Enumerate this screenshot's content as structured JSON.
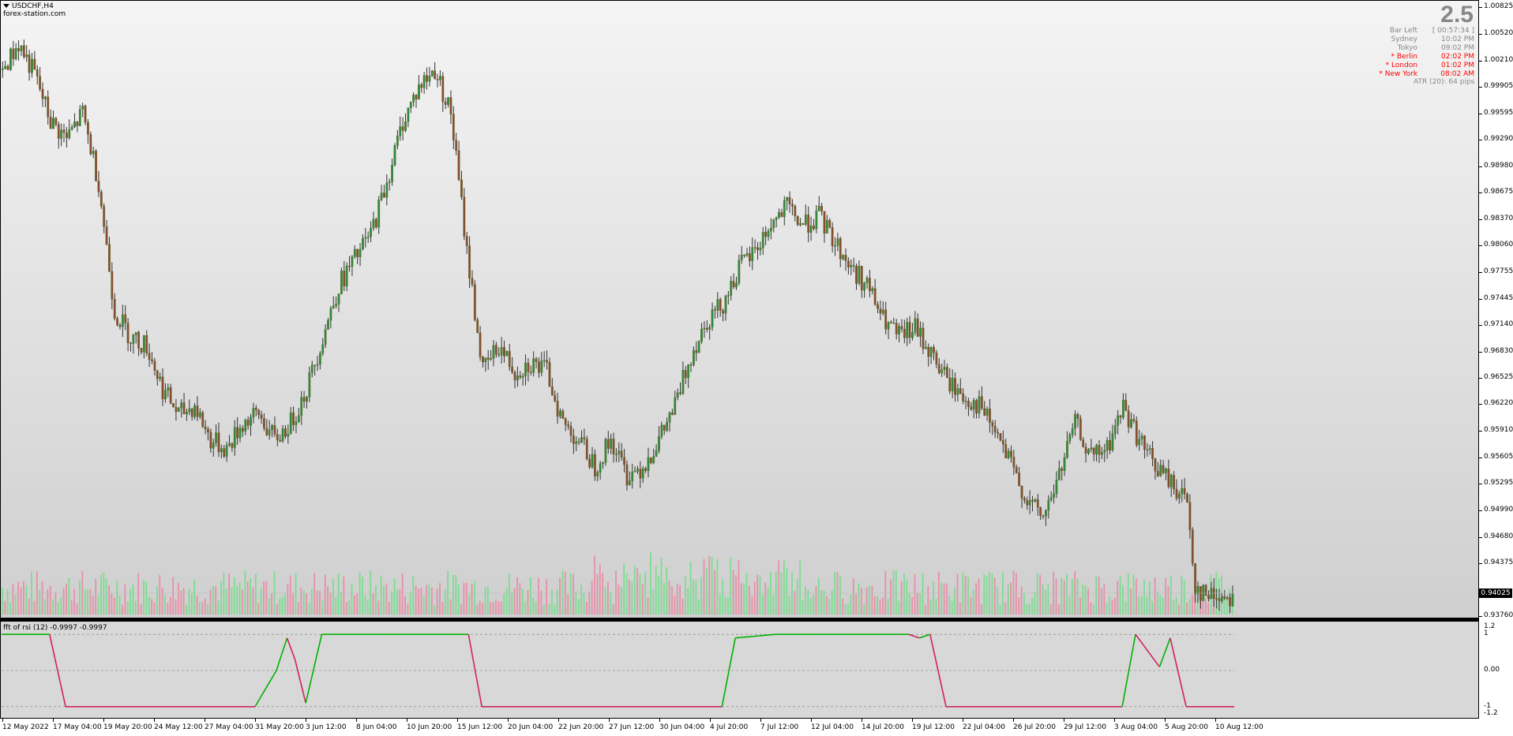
{
  "chart": {
    "symbol_label": "USDCHF,H4",
    "watermark": "forex-station.com",
    "big_value": "2.5",
    "current_price": "0.94025",
    "indicator_label": "fft of rsi (12) -0.9997 -0.9997"
  },
  "info_panel": [
    {
      "name": "Bar Left",
      "value": "[ 00:57:34 ]",
      "color": "#888888"
    },
    {
      "name": "Sydney",
      "value": "10:02 PM",
      "color": "#888888"
    },
    {
      "name": "Tokyo",
      "value": "09:02 PM",
      "color": "#888888"
    },
    {
      "name": "* Berlin",
      "value": "02:02 PM",
      "color": "#ff0000"
    },
    {
      "name": "* London",
      "value": "01:02 PM",
      "color": "#ff0000"
    },
    {
      "name": "* New York",
      "value": "08:02 AM",
      "color": "#ff0000"
    }
  ],
  "atr_label": "ATR (20): 64 pips",
  "price_axis": [
    "1.00825",
    "1.00520",
    "1.00210",
    "0.99905",
    "0.99595",
    "0.99290",
    "0.98980",
    "0.98675",
    "0.98370",
    "0.98060",
    "0.97755",
    "0.97445",
    "0.97140",
    "0.96830",
    "0.96525",
    "0.96220",
    "0.95910",
    "0.95605",
    "0.95295",
    "0.94990",
    "0.94680",
    "0.94375",
    "0.93760"
  ],
  "indicator_axis": [
    "1.2",
    "1",
    "0.00",
    "-1",
    "-1.2"
  ],
  "time_axis": [
    "12 May 2022",
    "17 May 04:00",
    "19 May 20:00",
    "24 May 12:00",
    "27 May 04:00",
    "31 May 20:00",
    "3 Jun 12:00",
    "8 Jun 04:00",
    "10 Jun 20:00",
    "15 Jun 12:00",
    "20 Jun 04:00",
    "22 Jun 20:00",
    "27 Jun 12:00",
    "30 Jun 04:00",
    "4 Jul 20:00",
    "7 Jul 12:00",
    "12 Jul 04:00",
    "14 Jul 20:00",
    "19 Jul 12:00",
    "22 Jul 04:00",
    "26 Jul 20:00",
    "29 Jul 12:00",
    "3 Aug 04:00",
    "5 Aug 20:00",
    "10 Aug 12:00"
  ],
  "colors": {
    "bull": "#00b000",
    "bear": "#ff4060",
    "candle_body": "#5a6b2a",
    "wick": "#333333"
  },
  "chart_data": {
    "type": "candlestick",
    "price_path": [
      [
        0,
        1.001
      ],
      [
        6,
        1.004
      ],
      [
        12,
        1.0005
      ],
      [
        18,
        0.995
      ],
      [
        24,
        0.993
      ],
      [
        30,
        0.996
      ],
      [
        36,
        0.988
      ],
      [
        42,
        0.973
      ],
      [
        48,
        0.97
      ],
      [
        54,
        0.969
      ],
      [
        60,
        0.964
      ],
      [
        66,
        0.961
      ],
      [
        72,
        0.962
      ],
      [
        78,
        0.958
      ],
      [
        84,
        0.957
      ],
      [
        90,
        0.96
      ],
      [
        96,
        0.961
      ],
      [
        102,
        0.958
      ],
      [
        108,
        0.96
      ],
      [
        114,
        0.964
      ],
      [
        120,
        0.97
      ],
      [
        126,
        0.976
      ],
      [
        132,
        0.979
      ],
      [
        138,
        0.982
      ],
      [
        144,
        0.988
      ],
      [
        150,
        0.995
      ],
      [
        156,
        0.999
      ],
      [
        162,
        1.001
      ],
      [
        168,
        0.996
      ],
      [
        174,
        0.98
      ],
      [
        180,
        0.966
      ],
      [
        186,
        0.969
      ],
      [
        192,
        0.966
      ],
      [
        198,
        0.967
      ],
      [
        204,
        0.966
      ],
      [
        210,
        0.96
      ],
      [
        216,
        0.958
      ],
      [
        222,
        0.955
      ],
      [
        228,
        0.958
      ],
      [
        234,
        0.954
      ],
      [
        240,
        0.955
      ],
      [
        246,
        0.958
      ],
      [
        252,
        0.962
      ],
      [
        258,
        0.968
      ],
      [
        264,
        0.972
      ],
      [
        270,
        0.974
      ],
      [
        276,
        0.978
      ],
      [
        282,
        0.98
      ],
      [
        288,
        0.983
      ],
      [
        294,
        0.985
      ],
      [
        300,
        0.983
      ],
      [
        306,
        0.984
      ],
      [
        312,
        0.981
      ],
      [
        318,
        0.978
      ],
      [
        324,
        0.976
      ],
      [
        330,
        0.972
      ],
      [
        336,
        0.97
      ],
      [
        342,
        0.971
      ],
      [
        348,
        0.968
      ],
      [
        354,
        0.965
      ],
      [
        360,
        0.963
      ],
      [
        366,
        0.962
      ],
      [
        372,
        0.959
      ],
      [
        378,
        0.955
      ],
      [
        384,
        0.951
      ],
      [
        390,
        0.949
      ],
      [
        396,
        0.954
      ],
      [
        402,
        0.96
      ],
      [
        408,
        0.956
      ],
      [
        414,
        0.957
      ],
      [
        420,
        0.962
      ],
      [
        426,
        0.958
      ],
      [
        432,
        0.955
      ],
      [
        438,
        0.953
      ],
      [
        444,
        0.951
      ],
      [
        447,
        0.941
      ],
      [
        451,
        0.94
      ]
    ],
    "indicator_path": [
      [
        0,
        1
      ],
      [
        18,
        1
      ],
      [
        24,
        -1
      ],
      [
        95,
        -1
      ],
      [
        103,
        0
      ],
      [
        107,
        0.9
      ],
      [
        110,
        0.3
      ],
      [
        114,
        -0.9
      ],
      [
        120,
        1
      ],
      [
        175,
        1
      ],
      [
        180,
        -1
      ],
      [
        270,
        -1
      ],
      [
        275,
        0.9
      ],
      [
        290,
        1
      ],
      [
        340,
        1
      ],
      [
        344,
        0.9
      ],
      [
        348,
        1
      ],
      [
        354,
        -1
      ],
      [
        420,
        -1
      ],
      [
        425,
        1
      ],
      [
        430,
        0.5
      ],
      [
        434,
        0.1
      ],
      [
        438,
        0.9
      ],
      [
        444,
        -1
      ],
      [
        462,
        -1
      ]
    ],
    "price_ylim": [
      0.9376,
      1.0082
    ],
    "indicator_ylim": [
      -1.2,
      1.2
    ]
  }
}
